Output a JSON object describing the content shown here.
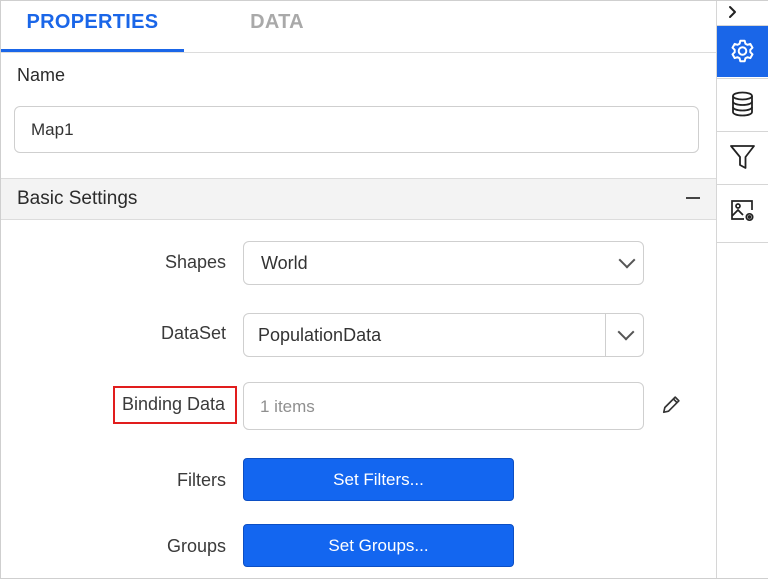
{
  "tabs": [
    {
      "label": "PROPERTIES",
      "active": true
    },
    {
      "label": "DATA",
      "active": false
    }
  ],
  "name_section": {
    "label": "Name",
    "value": "Map1"
  },
  "basic_settings": {
    "title": "Basic Settings",
    "collapse_icon": "minus-icon",
    "shapes": {
      "label": "Shapes",
      "value": "World"
    },
    "dataset": {
      "label": "DataSet",
      "value": "PopulationData"
    },
    "binding_data": {
      "label": "Binding Data",
      "placeholder": "1 items",
      "edit_icon": "pencil-icon"
    },
    "filters": {
      "label": "Filters",
      "button": "Set Filters..."
    },
    "groups": {
      "label": "Groups",
      "button": "Set Groups..."
    }
  },
  "rail": {
    "expand_icon": "chevron-right-icon",
    "items": [
      {
        "icon": "gear-icon",
        "active": true
      },
      {
        "icon": "database-icon",
        "active": false
      },
      {
        "icon": "filter-icon",
        "active": false
      },
      {
        "icon": "image-settings-icon",
        "active": false
      }
    ]
  },
  "colors": {
    "accent": "#1a66e8",
    "button": "#1366f0",
    "highlight_border": "#e11d1d",
    "inactive_tab": "#a9a9a9"
  }
}
